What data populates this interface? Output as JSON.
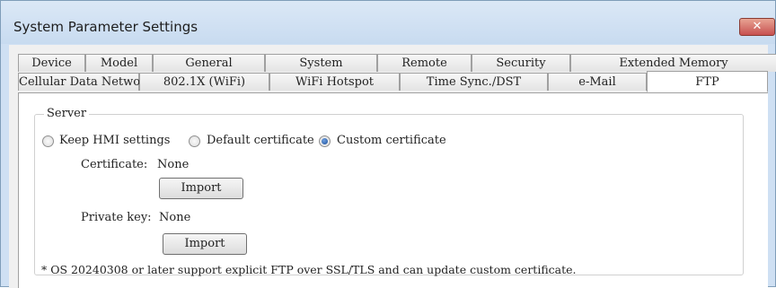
{
  "window": {
    "title": "System Parameter Settings",
    "close_icon": "✕"
  },
  "tabs_row1": [
    {
      "label": "Device"
    },
    {
      "label": "Model"
    },
    {
      "label": "General"
    },
    {
      "label": "System"
    },
    {
      "label": "Remote"
    },
    {
      "label": "Security"
    },
    {
      "label": "Extended Memory"
    }
  ],
  "tabs_row2": [
    {
      "label": "Cellular Data Network"
    },
    {
      "label": "802.1X (WiFi)"
    },
    {
      "label": "WiFi Hotspot"
    },
    {
      "label": "Time Sync./DST"
    },
    {
      "label": "e-Mail"
    },
    {
      "label": "FTP",
      "active": true
    }
  ],
  "server": {
    "group_title": "Server",
    "options": [
      {
        "label": "Keep HMI settings",
        "checked": false
      },
      {
        "label": "Default certificate",
        "checked": false
      },
      {
        "label": "Custom certificate",
        "checked": true
      }
    ],
    "certificate_label": "Certificate:",
    "certificate_value": "None",
    "import_cert_label": "Import",
    "private_key_label": "Private key:",
    "private_key_value": "None",
    "import_key_label": "Import",
    "note": "* OS 20240308 or later support explicit FTP over SSL/TLS and can update custom certificate."
  },
  "colors": {
    "accent": "#1b4f9a",
    "close": "#c75050"
  }
}
